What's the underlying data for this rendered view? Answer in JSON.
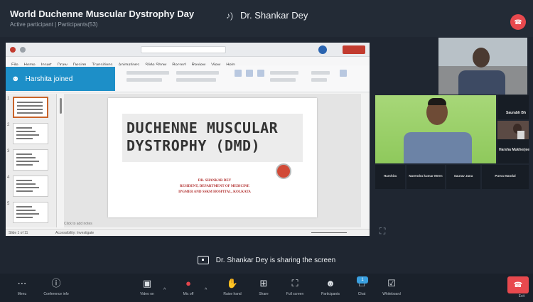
{
  "meeting": {
    "title": "World Duchenne Muscular Dystrophy Day",
    "subtitle": "Active participant  |  Participants(53)",
    "active_speaker": "Dr. Shankar Dey"
  },
  "notification": {
    "text": "Harshita joined"
  },
  "presentation": {
    "title_line1": "DUCHENNE MUSCULAR",
    "title_line2": "DYSTROPHY (DMD)",
    "presenter_name": "DR. SHANKAR DEY",
    "presenter_role": "RESIDENT, DEPARTMENT OF MEDICINE",
    "presenter_org": "IPGMER AND SSKM HOSPITAL, KOLKATA",
    "menu": [
      "File",
      "Home",
      "Insert",
      "Draw",
      "Design",
      "Transitions",
      "Animations",
      "Slide Show",
      "Record",
      "Review",
      "View",
      "Help"
    ],
    "notes_placeholder": "Click to add notes",
    "status_left": "Slide 1 of 11",
    "status_mid": "Accessibility: Investigate",
    "thumb_numbers": [
      "1",
      "2",
      "3",
      "4",
      "5"
    ]
  },
  "participants": {
    "tile_top": "",
    "side_tiles": [
      "Saurabh Bh",
      "Harsha Mukherjee"
    ],
    "grid_names": [
      "Harshita",
      "Narendra kumar Meen",
      "Saurav Jana",
      "Purva Mandal"
    ]
  },
  "share_banner": "Dr. Shankar Dey is sharing the screen",
  "toolbar": {
    "menu": "Menu",
    "conference_info": "Conference info",
    "video": "Video on",
    "mic": "Mic off",
    "raise_hand": "Raise hand",
    "share": "Share",
    "full_screen": "Full screen",
    "participants": "Participants",
    "chat": "Chat",
    "chat_count": "1",
    "whiteboard": "Whiteboard",
    "exit": "Exit"
  },
  "icons": {
    "leave": "phone-hangup-icon",
    "speaker": "speaker-icon",
    "toast": "user-icon"
  },
  "colors": {
    "background": "#1f2631",
    "toast": "#1d8fc8",
    "leave": "#e8494e",
    "slide_title": "#333333",
    "slide_subtitle": "#b1302f"
  }
}
